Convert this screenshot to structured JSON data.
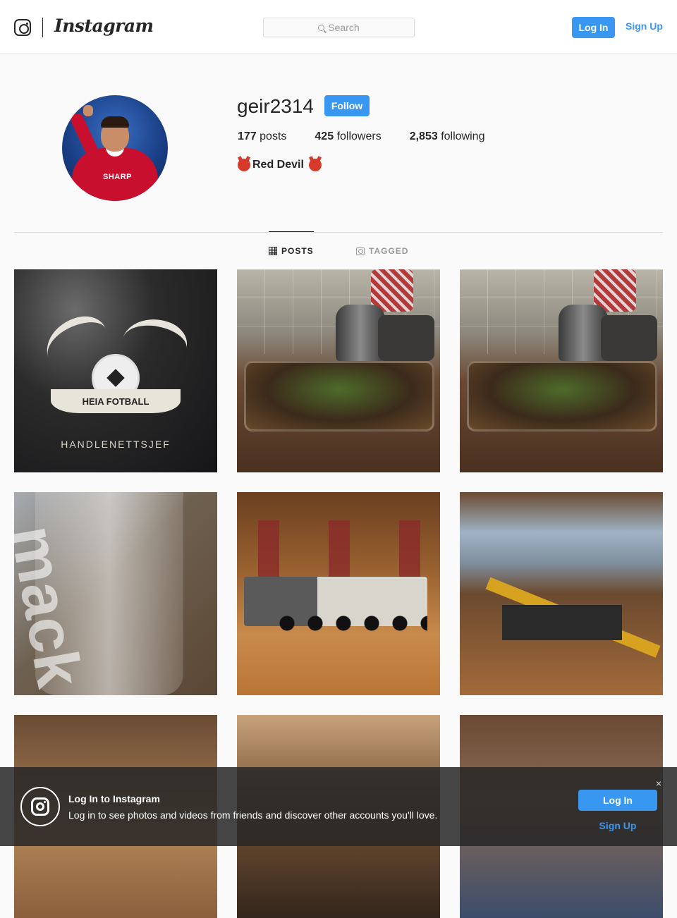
{
  "header": {
    "brand": "Instagram",
    "search_placeholder": "Search",
    "login_label": "Log In",
    "signup_label": "Sign Up"
  },
  "profile": {
    "username": "geir2314",
    "follow_label": "Follow",
    "stats": [
      {
        "count": "177",
        "label": "posts"
      },
      {
        "count": "425",
        "label": "followers"
      },
      {
        "count": "2,853",
        "label": "following"
      }
    ],
    "bio": "Red Devil",
    "avatar_sponsor_text": "SHARP"
  },
  "tabs": [
    {
      "label": "POSTS",
      "icon": "grid-icon",
      "active": true
    },
    {
      "label": "TAGGED",
      "icon": "tagged-icon",
      "active": false
    }
  ],
  "posts": {
    "shirt_banner": "HEIA FOTBALL",
    "shirt_caption": "HANDLENETTSJEF",
    "glass_text": "mack"
  },
  "overlay": {
    "title": "Log In to Instagram",
    "description": "Log in to see photos and videos from friends and discover other accounts you'll love.",
    "close_label": "×",
    "login_label": "Log In",
    "signup_label": "Sign Up"
  },
  "colors": {
    "accent": "#3897f0",
    "text": "#262626",
    "background": "#fafafa"
  }
}
